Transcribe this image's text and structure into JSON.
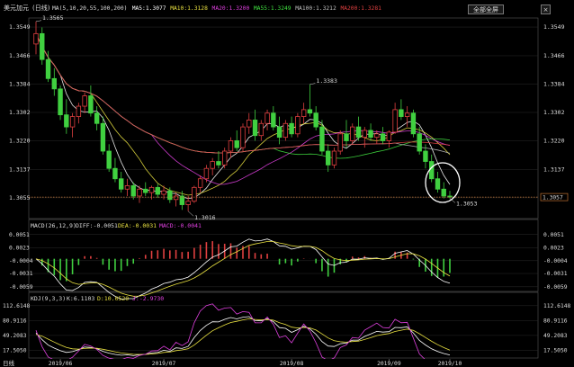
{
  "header": {
    "symbol": "美元加元",
    "period": "(日线)",
    "ma_labels": [
      {
        "text": "MA(5,10,20,55,100,200)",
        "color": "#dddddd"
      },
      {
        "text": "MA5:1.3077",
        "color": "#ffffff"
      },
      {
        "text": "MA10:1.3128",
        "color": "#e8e040"
      },
      {
        "text": "MA20:1.3200",
        "color": "#e040e0"
      },
      {
        "text": "MA55:1.3249",
        "color": "#40e040"
      },
      {
        "text": "MA100:1.3212",
        "color": "#c0c0c0"
      },
      {
        "text": "MA200:1.3281",
        "color": "#e04040"
      }
    ],
    "fullscreen_button": "全部全屏",
    "close_button": "×"
  },
  "price_axis": {
    "ticks": [
      "1.3549",
      "1.3466",
      "1.3384",
      "1.3302",
      "1.3220",
      "1.3137",
      "1.3055"
    ],
    "current_price": "1.3057"
  },
  "annotations": {
    "high_label": "1.3565",
    "low_label": "1.3016",
    "mid_high_label": "1.3383",
    "last_low_label": "1.3053"
  },
  "macd": {
    "title": "MACD(26,12,9)",
    "diff": "DIFF:-0.0051",
    "dea": "DEA:-0.0031",
    "macd": "MACD:-0.0041",
    "ticks": [
      "0.0051",
      "0.0023",
      "-0.0004",
      "-0.0031",
      "-0.0059"
    ]
  },
  "kdj": {
    "title": "KDJ(9,3,3)",
    "k": "K:6.1103",
    "d": "D:10.0520",
    "j": "J:-2.9730",
    "ticks": [
      "112.6148",
      "80.9116",
      "49.2083",
      "17.5050"
    ]
  },
  "date_axis": {
    "corner_label": "日线",
    "dates": [
      "2019/06",
      "2019/07",
      "2019/08",
      "2019/09",
      "2019/10"
    ]
  },
  "colors": {
    "up": "#e04040",
    "down": "#40d040",
    "ma5": "#ffffff",
    "ma10": "#e8e040",
    "ma20": "#e040e0",
    "ma55": "#40e040",
    "ma100": "#c0c0c0",
    "ma200": "#e04040",
    "grid": "#2a2a2a",
    "dotted": "#c07030"
  },
  "chart_data": [
    {
      "type": "candlestick",
      "title": "美元加元(日线)",
      "ylim": [
        1.3,
        1.357
      ],
      "y_ticks": [
        1.3549,
        1.3466,
        1.3384,
        1.3302,
        1.322,
        1.3137,
        1.3055
      ],
      "x_labels": [
        "2019/06",
        "2019/07",
        "2019/08",
        "2019/09",
        "2019/10"
      ],
      "ohlc": [
        [
          1.35,
          1.3565,
          1.347,
          1.353
        ],
        [
          1.353,
          1.3548,
          1.344,
          1.3455
        ],
        [
          1.3455,
          1.348,
          1.339,
          1.34
        ],
        [
          1.34,
          1.343,
          1.335,
          1.337
        ],
        [
          1.337,
          1.338,
          1.328,
          1.3295
        ],
        [
          1.3295,
          1.334,
          1.324,
          1.326
        ],
        [
          1.326,
          1.33,
          1.323,
          1.329
        ],
        [
          1.329,
          1.333,
          1.327,
          1.332
        ],
        [
          1.332,
          1.336,
          1.33,
          1.335
        ],
        [
          1.335,
          1.338,
          1.329,
          1.33
        ],
        [
          1.33,
          1.332,
          1.325,
          1.327
        ],
        [
          1.327,
          1.329,
          1.318,
          1.319
        ],
        [
          1.319,
          1.321,
          1.313,
          1.314
        ],
        [
          1.314,
          1.317,
          1.31,
          1.311
        ],
        [
          1.311,
          1.313,
          1.307,
          1.308
        ],
        [
          1.308,
          1.311,
          1.306,
          1.309
        ],
        [
          1.309,
          1.31,
          1.305,
          1.306
        ],
        [
          1.306,
          1.309,
          1.304,
          1.308
        ],
        [
          1.308,
          1.31,
          1.306,
          1.307
        ],
        [
          1.307,
          1.309,
          1.305,
          1.3085
        ],
        [
          1.3085,
          1.3095,
          1.3055,
          1.3065
        ],
        [
          1.3065,
          1.309,
          1.305,
          1.3075
        ],
        [
          1.3075,
          1.3085,
          1.304,
          1.305
        ],
        [
          1.305,
          1.307,
          1.303,
          1.306
        ],
        [
          1.306,
          1.3075,
          1.302,
          1.3035
        ],
        [
          1.3035,
          1.306,
          1.3016,
          1.3045
        ],
        [
          1.3045,
          1.309,
          1.304,
          1.3085
        ],
        [
          1.3085,
          1.312,
          1.307,
          1.311
        ],
        [
          1.311,
          1.315,
          1.31,
          1.314
        ],
        [
          1.314,
          1.317,
          1.312,
          1.316
        ],
        [
          1.316,
          1.319,
          1.314,
          1.315
        ],
        [
          1.315,
          1.32,
          1.314,
          1.319
        ],
        [
          1.319,
          1.323,
          1.317,
          1.322
        ],
        [
          1.322,
          1.325,
          1.319,
          1.32
        ],
        [
          1.32,
          1.327,
          1.319,
          1.326
        ],
        [
          1.326,
          1.33,
          1.324,
          1.328
        ],
        [
          1.328,
          1.331,
          1.322,
          1.3235
        ],
        [
          1.3235,
          1.328,
          1.322,
          1.327
        ],
        [
          1.327,
          1.331,
          1.325,
          1.33
        ],
        [
          1.33,
          1.332,
          1.325,
          1.326
        ],
        [
          1.326,
          1.329,
          1.321,
          1.323
        ],
        [
          1.323,
          1.328,
          1.322,
          1.327
        ],
        [
          1.327,
          1.329,
          1.323,
          1.324
        ],
        [
          1.324,
          1.33,
          1.323,
          1.329
        ],
        [
          1.329,
          1.333,
          1.327,
          1.331
        ],
        [
          1.331,
          1.3383,
          1.329,
          1.33
        ],
        [
          1.33,
          1.332,
          1.325,
          1.326
        ],
        [
          1.326,
          1.328,
          1.318,
          1.319
        ],
        [
          1.319,
          1.321,
          1.313,
          1.315
        ],
        [
          1.315,
          1.32,
          1.314,
          1.319
        ],
        [
          1.319,
          1.325,
          1.318,
          1.324
        ],
        [
          1.324,
          1.328,
          1.32,
          1.322
        ],
        [
          1.322,
          1.327,
          1.321,
          1.326
        ],
        [
          1.326,
          1.329,
          1.322,
          1.323
        ],
        [
          1.323,
          1.326,
          1.32,
          1.325
        ],
        [
          1.325,
          1.327,
          1.322,
          1.323
        ],
        [
          1.323,
          1.325,
          1.321,
          1.324
        ],
        [
          1.324,
          1.326,
          1.321,
          1.322
        ],
        [
          1.322,
          1.325,
          1.32,
          1.3245
        ],
        [
          1.3245,
          1.333,
          1.324,
          1.331
        ],
        [
          1.331,
          1.334,
          1.328,
          1.329
        ],
        [
          1.329,
          1.332,
          1.326,
          1.33
        ],
        [
          1.33,
          1.331,
          1.323,
          1.324
        ],
        [
          1.324,
          1.326,
          1.318,
          1.319
        ],
        [
          1.319,
          1.321,
          1.314,
          1.316
        ],
        [
          1.316,
          1.318,
          1.31,
          1.311
        ],
        [
          1.311,
          1.313,
          1.307,
          1.308
        ],
        [
          1.308,
          1.31,
          1.3053,
          1.306
        ],
        [
          1.306,
          1.3075,
          1.3053,
          1.3057
        ]
      ]
    },
    {
      "type": "bar",
      "title": "MACD(26,12,9)",
      "ylim": [
        -0.0065,
        0.006
      ],
      "series": [
        {
          "name": "DIFF",
          "value": -0.0051
        },
        {
          "name": "DEA",
          "value": -0.0031
        },
        {
          "name": "MACD",
          "value": -0.0041
        }
      ]
    },
    {
      "type": "line",
      "title": "KDJ(9,3,3)",
      "ylim": [
        5,
        118
      ],
      "series": [
        {
          "name": "K",
          "value": 6.1103
        },
        {
          "name": "D",
          "value": 10.052
        },
        {
          "name": "J",
          "value": -2.973
        }
      ]
    }
  ]
}
